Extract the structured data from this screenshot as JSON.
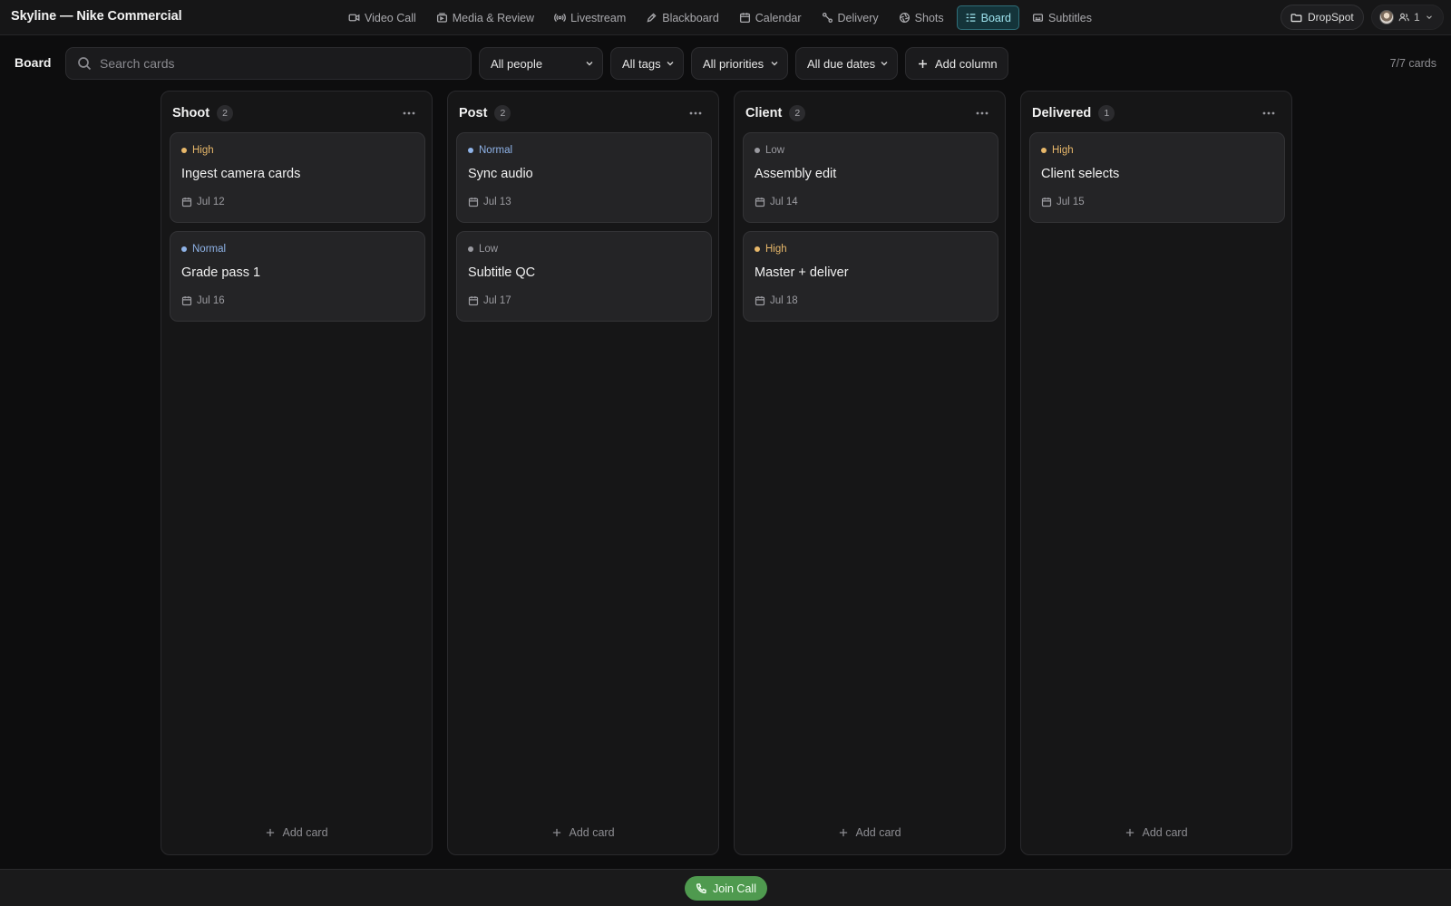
{
  "app": {
    "title": "Skyline — Nike Commercial"
  },
  "nav": {
    "items": [
      {
        "label": "Video Call",
        "icon": "video-camera-icon"
      },
      {
        "label": "Media & Review",
        "icon": "media-icon"
      },
      {
        "label": "Livestream",
        "icon": "broadcast-icon"
      },
      {
        "label": "Blackboard",
        "icon": "pen-icon"
      },
      {
        "label": "Calendar",
        "icon": "calendar-icon"
      },
      {
        "label": "Delivery",
        "icon": "route-icon"
      },
      {
        "label": "Shots",
        "icon": "aperture-icon"
      },
      {
        "label": "Board",
        "icon": "board-icon",
        "active": true
      },
      {
        "label": "Subtitles",
        "icon": "subtitles-icon"
      }
    ]
  },
  "header_right": {
    "dropspot_label": "DropSpot",
    "presence_count": "1"
  },
  "toolbar": {
    "board_label": "Board",
    "search_placeholder": "Search cards",
    "search_value": "",
    "filters": {
      "people": "All people",
      "tags": "All tags",
      "priorities": "All priorities",
      "due_dates": "All due dates"
    },
    "add_column_label": "Add column",
    "card_count": "7/7 cards"
  },
  "priority_colors": {
    "High": "#e8b86a",
    "Normal": "#8fb3e8",
    "Low": "#9a9aa0"
  },
  "columns": [
    {
      "title": "Shoot",
      "count": "2",
      "add_label": "Add card",
      "cards": [
        {
          "priority": "High",
          "title": "Ingest camera cards",
          "due": "Jul 12"
        },
        {
          "priority": "Normal",
          "title": "Grade pass 1",
          "due": "Jul 16"
        }
      ]
    },
    {
      "title": "Post",
      "count": "2",
      "add_label": "Add card",
      "cards": [
        {
          "priority": "Normal",
          "title": "Sync audio",
          "due": "Jul 13"
        },
        {
          "priority": "Low",
          "title": "Subtitle QC",
          "due": "Jul 17"
        }
      ]
    },
    {
      "title": "Client",
      "count": "2",
      "add_label": "Add card",
      "cards": [
        {
          "priority": "Low",
          "title": "Assembly edit",
          "due": "Jul 14"
        },
        {
          "priority": "High",
          "title": "Master + deliver",
          "due": "Jul 18"
        }
      ]
    },
    {
      "title": "Delivered",
      "count": "1",
      "add_label": "Add card",
      "cards": [
        {
          "priority": "High",
          "title": "Client selects",
          "due": "Jul 15"
        }
      ]
    }
  ],
  "footer": {
    "join_call_label": "Join Call"
  }
}
